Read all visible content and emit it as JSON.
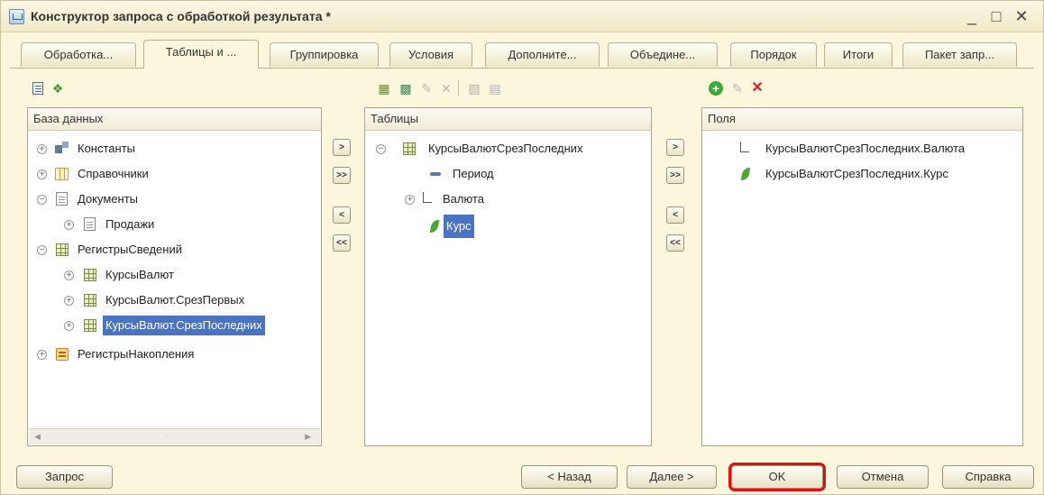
{
  "window": {
    "title": "Конструктор запроса с обработкой результата *",
    "minimize": "_",
    "maximize": "□",
    "close": "✕"
  },
  "tabs": [
    {
      "label": "Обработка..."
    },
    {
      "label": "Таблицы и ..."
    },
    {
      "label": "Группировка"
    },
    {
      "label": "Условия"
    },
    {
      "label": "Дополните..."
    },
    {
      "label": "Объедине..."
    },
    {
      "label": "Порядок"
    },
    {
      "label": "Итоги"
    },
    {
      "label": "Пакет запр..."
    }
  ],
  "database_panel": {
    "header": "База данных",
    "items": [
      {
        "label": "Константы",
        "expander": "+",
        "icon": "constants-icon"
      },
      {
        "label": "Справочники",
        "expander": "+",
        "icon": "catalog-icon"
      },
      {
        "label": "Документы",
        "expander": "−",
        "icon": "document-icon"
      },
      {
        "label": "Продажи",
        "expander": "+",
        "icon": "document-icon"
      },
      {
        "label": "РегистрыСведений",
        "expander": "−",
        "icon": "table-icon"
      },
      {
        "label": "КурсыВалют",
        "expander": "+",
        "icon": "table-icon"
      },
      {
        "label": "КурсыВалют.СрезПервых",
        "expander": "+",
        "icon": "table-icon"
      },
      {
        "label": "КурсыВалют.СрезПоследних",
        "expander": "+",
        "icon": "table-icon"
      },
      {
        "label": "РегистрыНакопления",
        "expander": "+",
        "icon": "accumulation-icon"
      }
    ]
  },
  "tables_panel": {
    "header": "Таблицы",
    "items": [
      {
        "label": "КурсыВалютСрезПоследних",
        "expander": "−",
        "icon": "table-icon"
      },
      {
        "label": "Период",
        "icon": "dimension-icon"
      },
      {
        "label": "Валюта",
        "expander": "+",
        "icon": "reference-icon"
      },
      {
        "label": "Курс",
        "icon": "resource-icon"
      }
    ]
  },
  "fields_panel": {
    "header": "Поля",
    "items": [
      {
        "label": "КурсыВалютСрезПоследних.Валюта",
        "icon": "reference-icon"
      },
      {
        "label": "КурсыВалютСрезПоследних.Курс",
        "icon": "resource-icon"
      }
    ]
  },
  "transfer_buttons": {
    "add": ">",
    "add_all": ">>",
    "remove": "<",
    "remove_all": "<<"
  },
  "buttons": {
    "query": "Запрос",
    "back": "< Назад",
    "next": "Далее >",
    "ok": "OK",
    "cancel": "Отмена",
    "help": "Справка"
  },
  "colors": {
    "window_bg": "#fbf6dc",
    "selection": "#4a73c0",
    "ok_highlight": "#e01010",
    "delete_red": "#e02020",
    "add_green": "#3aaa3a"
  }
}
